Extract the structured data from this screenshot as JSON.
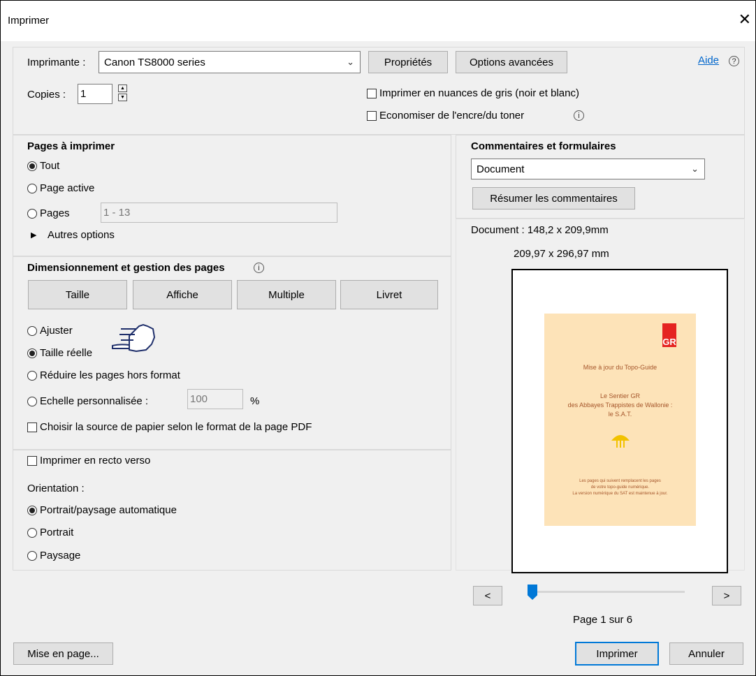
{
  "window": {
    "title": "Imprimer",
    "close_glyph": "✕"
  },
  "printer": {
    "label": "Imprimante :",
    "selected": "Canon TS8000 series",
    "properties_button": "Propriétés",
    "advanced_button": "Options avancées",
    "help_link": "Aide",
    "help_icon": "question-circle-icon"
  },
  "copies": {
    "label": "Copies :",
    "value": "1"
  },
  "options": {
    "grayscale": "Imprimer en nuances de gris (noir et blanc)",
    "save_ink": "Economiser de l'encre/du toner"
  },
  "pages": {
    "heading": "Pages à imprimer",
    "all": "Tout",
    "current": "Page active",
    "range_label": "Pages",
    "range_value": "1 - 13",
    "more": "Autres options",
    "selected": "Tout"
  },
  "sizing": {
    "heading": "Dimensionnement et gestion des pages",
    "tabs": [
      "Taille",
      "Affiche",
      "Multiple",
      "Livret"
    ],
    "fit": "Ajuster",
    "actual": "Taille réelle",
    "shrink": "Réduire les pages hors format",
    "custom": "Echelle personnalisée :",
    "custom_value": "100",
    "custom_unit": "%",
    "paper_source": "Choisir la source de papier selon le format de la page PDF",
    "selected": "Taille réelle"
  },
  "duplex": {
    "label": "Imprimer en recto verso",
    "orientation_label": "Orientation :",
    "auto": "Portrait/paysage automatique",
    "portrait": "Portrait",
    "landscape": "Paysage",
    "selected": "Portrait/paysage automatique"
  },
  "comments": {
    "heading": "Commentaires et formulaires",
    "selected": "Document",
    "summarize_button": "Résumer les commentaires"
  },
  "preview": {
    "doc_size": "Document : 148,2 x 209,9mm",
    "paper_size": "209,97 x 296,97 mm",
    "page_status": "Page 1 sur 6",
    "prev": "<",
    "next": ">",
    "slider_fraction": 0.0,
    "doc": {
      "logo": "GR",
      "line1": "Mise à jour du Topo-Guide",
      "line2": "Le Sentier GR",
      "line3": "des Abbayes Trappistes de Wallonie :",
      "line4": "le S.A.T.",
      "foot1": "Les pages qui suivent remplacent les pages",
      "foot2": "de votre topo-guide numérique.",
      "foot3": "La version numérique du SAT est maintenue à jour."
    }
  },
  "footer": {
    "page_setup": "Mise en page...",
    "print": "Imprimer",
    "cancel": "Annuler"
  },
  "colors": {
    "accent": "#0078d7",
    "link": "#0066cc",
    "paper": "#fde3b8",
    "logo_red": "#e52320"
  }
}
